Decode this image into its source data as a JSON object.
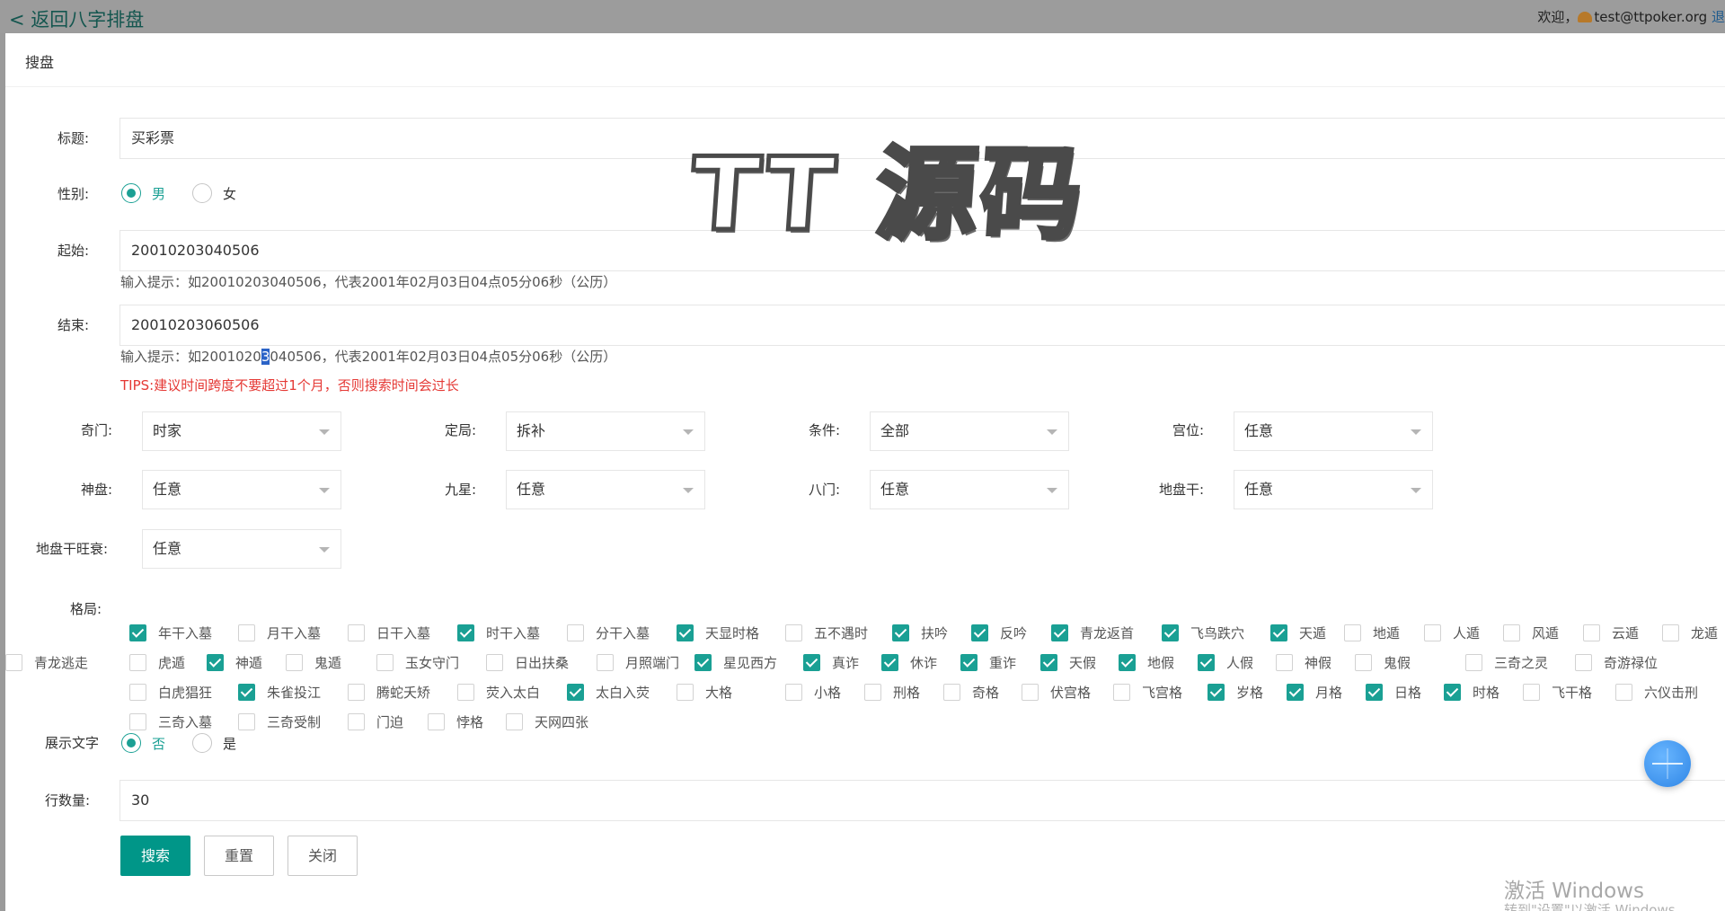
{
  "page": {
    "back_link": "< 返回八字排盘",
    "welcome": "欢迎，",
    "user_email": "test@ttpoker.org",
    "logout": "退"
  },
  "modal": {
    "title": "搜盘"
  },
  "form": {
    "title_label": "标题:",
    "title_value": "买彩票",
    "gender_label": "性别:",
    "gender_options": [
      "男",
      "女"
    ],
    "gender_selected": "男",
    "start_label": "起始:",
    "start_value": "20010203040506",
    "start_hint": "输入提示：如20010203040506，代表2001年02月03日04点05分06秒（公历）",
    "end_label": "结束:",
    "end_value": "20010203060506",
    "end_hint_a": "输入提示：如2001020",
    "end_hint_sel": "3",
    "end_hint_b": "040506，代表2001年02月03日04点05分06秒（公历）",
    "tips": "TIPS:建议时间跨度不要超过1个月，否则搜索时间会过长",
    "selects": [
      {
        "label": "奇门:",
        "value": "时家"
      },
      {
        "label": "定局:",
        "value": "拆补"
      },
      {
        "label": "条件:",
        "value": "全部"
      },
      {
        "label": "宫位:",
        "value": "任意"
      },
      {
        "label": "神盘:",
        "value": "任意"
      },
      {
        "label": "九星:",
        "value": "任意"
      },
      {
        "label": "八门:",
        "value": "任意"
      },
      {
        "label": "地盘干:",
        "value": "任意"
      },
      {
        "label": "地盘干旺衰:",
        "value": "任意"
      }
    ],
    "pattern_label": "格局:",
    "patterns": [
      {
        "label": "年干入墓",
        "checked": true
      },
      {
        "label": "月干入墓",
        "checked": false
      },
      {
        "label": "日干入墓",
        "checked": false
      },
      {
        "label": "时干入墓",
        "checked": true
      },
      {
        "label": "分干入墓",
        "checked": false
      },
      {
        "label": "天显时格",
        "checked": true
      },
      {
        "label": "五不遇时",
        "checked": false
      },
      {
        "label": "扶吟",
        "checked": true
      },
      {
        "label": "反吟",
        "checked": true
      },
      {
        "label": "青龙返首",
        "checked": true
      },
      {
        "label": "飞鸟跌穴",
        "checked": true
      },
      {
        "label": "天遁",
        "checked": true
      },
      {
        "label": "地遁",
        "checked": false
      },
      {
        "label": "人遁",
        "checked": false
      },
      {
        "label": "风遁",
        "checked": false
      },
      {
        "label": "云遁",
        "checked": false
      },
      {
        "label": "龙遁",
        "checked": false
      },
      {
        "label": "虎遁",
        "checked": false
      },
      {
        "label": "神遁",
        "checked": true
      },
      {
        "label": "鬼遁",
        "checked": false
      },
      {
        "label": "玉女守门",
        "checked": false
      },
      {
        "label": "日出扶桑",
        "checked": false
      },
      {
        "label": "月照端门",
        "checked": false
      },
      {
        "label": "星见西方",
        "checked": true
      },
      {
        "label": "真诈",
        "checked": true
      },
      {
        "label": "休诈",
        "checked": true
      },
      {
        "label": "重诈",
        "checked": true
      },
      {
        "label": "天假",
        "checked": true
      },
      {
        "label": "地假",
        "checked": true
      },
      {
        "label": "人假",
        "checked": true
      },
      {
        "label": "神假",
        "checked": false
      },
      {
        "label": "鬼假",
        "checked": false
      },
      {
        "label": "三奇之灵",
        "checked": false
      },
      {
        "label": "奇游禄位",
        "checked": false
      },
      {
        "label": "青龙逃走",
        "checked": false
      },
      {
        "label": "白虎猖狂",
        "checked": false
      },
      {
        "label": "朱雀投江",
        "checked": true
      },
      {
        "label": "腾蛇夭矫",
        "checked": false
      },
      {
        "label": "荧入太白",
        "checked": false
      },
      {
        "label": "太白入荧",
        "checked": true
      },
      {
        "label": "大格",
        "checked": false
      },
      {
        "label": "小格",
        "checked": false
      },
      {
        "label": "刑格",
        "checked": false
      },
      {
        "label": "奇格",
        "checked": false
      },
      {
        "label": "伏宫格",
        "checked": false
      },
      {
        "label": "飞宫格",
        "checked": false
      },
      {
        "label": "岁格",
        "checked": true
      },
      {
        "label": "月格",
        "checked": true
      },
      {
        "label": "日格",
        "checked": true
      },
      {
        "label": "时格",
        "checked": true
      },
      {
        "label": "飞干格",
        "checked": false
      },
      {
        "label": "六仪击刑",
        "checked": false
      },
      {
        "label": "三奇入墓",
        "checked": false
      },
      {
        "label": "三奇受制",
        "checked": false
      },
      {
        "label": "门迫",
        "checked": false
      },
      {
        "label": "悖格",
        "checked": false
      },
      {
        "label": "天网四张",
        "checked": false
      }
    ],
    "show_text_label": "展示文字",
    "show_text_options": [
      "否",
      "是"
    ],
    "show_text_selected": "否",
    "rows_label": "行数量:",
    "rows_value": "30",
    "buttons": {
      "search": "搜索",
      "reset": "重置",
      "close": "关闭"
    }
  },
  "overlay": {
    "watermark": "TT 源码",
    "activate_title": "激活 Windows",
    "activate_sub": "转到\"设置\"以激活 Windows"
  }
}
